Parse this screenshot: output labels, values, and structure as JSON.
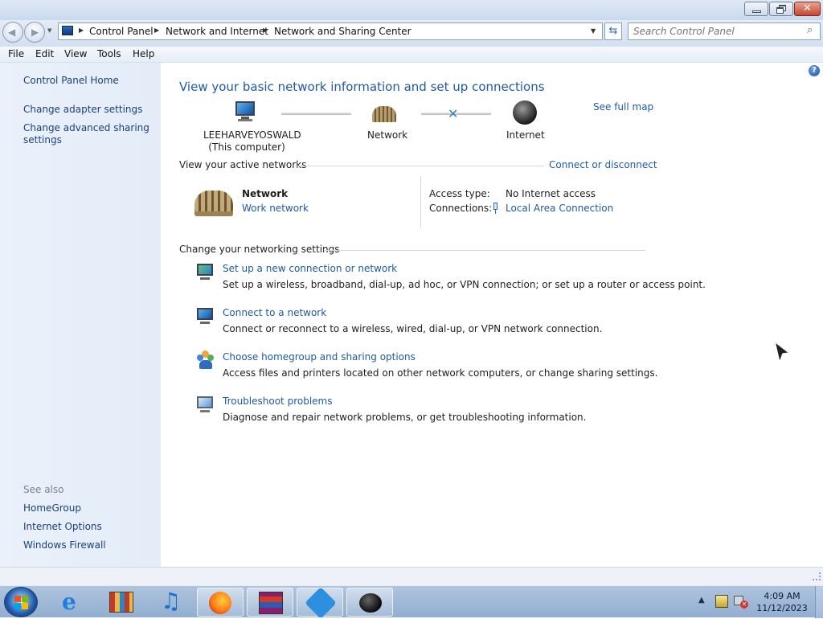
{
  "breadcrumb": [
    "Control Panel",
    "Network and Internet",
    "Network and Sharing Center"
  ],
  "search": {
    "placeholder": "Search Control Panel"
  },
  "menu": [
    "File",
    "Edit",
    "View",
    "Tools",
    "Help"
  ],
  "sidebar": {
    "home": "Control Panel Home",
    "links": [
      "Change adapter settings",
      "Change advanced sharing",
      "settings"
    ],
    "see_also_title": "See also",
    "see_also": [
      "HomeGroup",
      "Internet Options",
      "Windows Firewall"
    ]
  },
  "main": {
    "heading": "View your basic network information and set up connections",
    "see_full_map": "See full map",
    "map": {
      "computer_name": "LEEHARVEYOSWALD",
      "computer_sub": "(This computer)",
      "network": "Network",
      "internet": "Internet"
    },
    "active_networks": {
      "title": "View your active networks",
      "connect_link": "Connect or disconnect",
      "network_name": "Network",
      "network_type": "Work network",
      "access_type_label": "Access type:",
      "access_type_value": "No Internet access",
      "connections_label": "Connections:",
      "connections_value": "Local Area Connection"
    },
    "settings": {
      "title": "Change your networking settings",
      "tasks": [
        {
          "link": "Set up a new connection or network",
          "desc": "Set up a wireless, broadband, dial-up, ad hoc, or VPN connection; or set up a router or access point."
        },
        {
          "link": "Connect to a network",
          "desc": "Connect or reconnect to a wireless, wired, dial-up, or VPN network connection."
        },
        {
          "link": "Choose homegroup and sharing options",
          "desc": "Access files and printers located on other network computers, or change sharing settings."
        },
        {
          "link": "Troubleshoot problems",
          "desc": "Diagnose and repair network problems, or get troubleshooting information."
        }
      ]
    }
  },
  "clock": {
    "time": "4:09 AM",
    "date": "11/12/2023"
  },
  "colors": {
    "link": "#1e5aa8",
    "heading": "#1e5aa8",
    "sidebar_bg": "#e6eef9",
    "taskbar": "#9fb8d8"
  }
}
